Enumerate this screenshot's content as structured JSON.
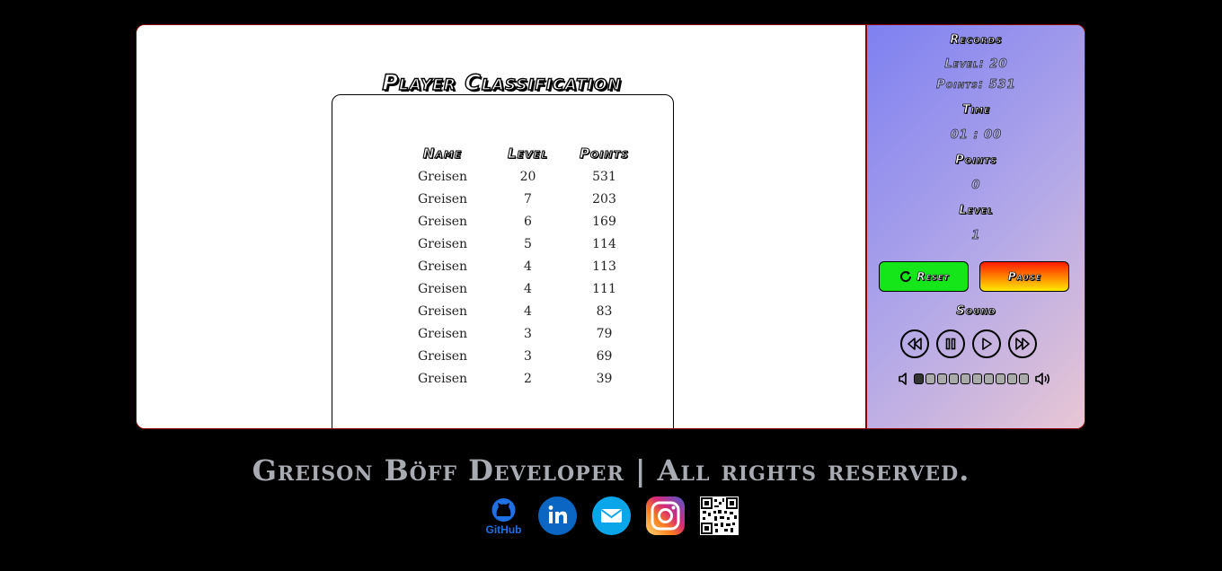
{
  "main": {
    "title": "Player Classification",
    "table": {
      "headers": [
        "Name",
        "Level",
        "Points"
      ],
      "rows": [
        [
          "Greisen",
          "20",
          "531"
        ],
        [
          "Greisen",
          "7",
          "203"
        ],
        [
          "Greisen",
          "6",
          "169"
        ],
        [
          "Greisen",
          "5",
          "114"
        ],
        [
          "Greisen",
          "4",
          "113"
        ],
        [
          "Greisen",
          "4",
          "111"
        ],
        [
          "Greisen",
          "4",
          "83"
        ],
        [
          "Greisen",
          "3",
          "79"
        ],
        [
          "Greisen",
          "3",
          "69"
        ],
        [
          "Greisen",
          "2",
          "39"
        ]
      ]
    }
  },
  "side": {
    "records_heading": "Records",
    "records_level": "Level: 20",
    "records_points": "Points: 531",
    "time_heading": "Time",
    "time_value": "01 : 00",
    "points_heading": "Points",
    "points_value": "0",
    "level_heading": "Level",
    "level_value": "1",
    "reset_label": "Reset",
    "pause_label": "Pause",
    "sound_heading": "Sound",
    "volume_level": 1,
    "volume_segments": 10,
    "colors": {
      "reset": "#14e61a",
      "pause_top": "#ff1a00",
      "pause_bottom": "#ffea00"
    }
  },
  "footer": {
    "text": "Greison Böff Developer | All rights reserved.",
    "github_label": "GitHub",
    "icons": [
      "github-icon",
      "linkedin-icon",
      "email-icon",
      "instagram-icon",
      "qr-code-icon"
    ]
  }
}
